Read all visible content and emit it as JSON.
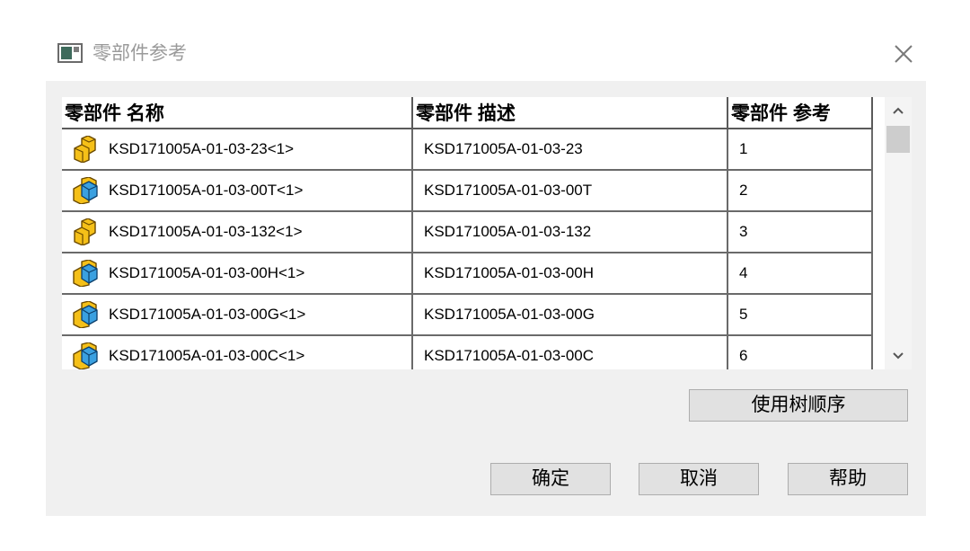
{
  "window": {
    "title": "零部件参考",
    "icon": "dialog-window-icon",
    "close_icon": "close-icon"
  },
  "table": {
    "columns": [
      "零部件 名称",
      "零部件 描述",
      "零部件 参考"
    ],
    "rows": [
      {
        "name": "KSD171005A-01-03-23<1>",
        "description": "KSD171005A-01-03-23",
        "ref": "1",
        "icon": "part-icon"
      },
      {
        "name": "KSD171005A-01-03-00T<1>",
        "description": "KSD171005A-01-03-00T",
        "ref": "2",
        "icon": "assembly-icon"
      },
      {
        "name": "KSD171005A-01-03-132<1>",
        "description": "KSD171005A-01-03-132",
        "ref": "3",
        "icon": "part-icon"
      },
      {
        "name": "KSD171005A-01-03-00H<1>",
        "description": "KSD171005A-01-03-00H",
        "ref": "4",
        "icon": "assembly-icon"
      },
      {
        "name": "KSD171005A-01-03-00G<1>",
        "description": "KSD171005A-01-03-00G",
        "ref": "5",
        "icon": "assembly-icon"
      },
      {
        "name": "KSD171005A-01-03-00C<1>",
        "description": "KSD171005A-01-03-00C",
        "ref": "6",
        "icon": "assembly-icon"
      }
    ]
  },
  "buttons": {
    "use_tree_order": "使用树顺序",
    "ok": "确定",
    "cancel": "取消",
    "help": "帮助"
  },
  "colors": {
    "dialog_bg": "#f0f0f0",
    "button_bg": "#e1e1e1",
    "icon_yellow": "#f5c018",
    "icon_blue": "#3aa0e0"
  }
}
